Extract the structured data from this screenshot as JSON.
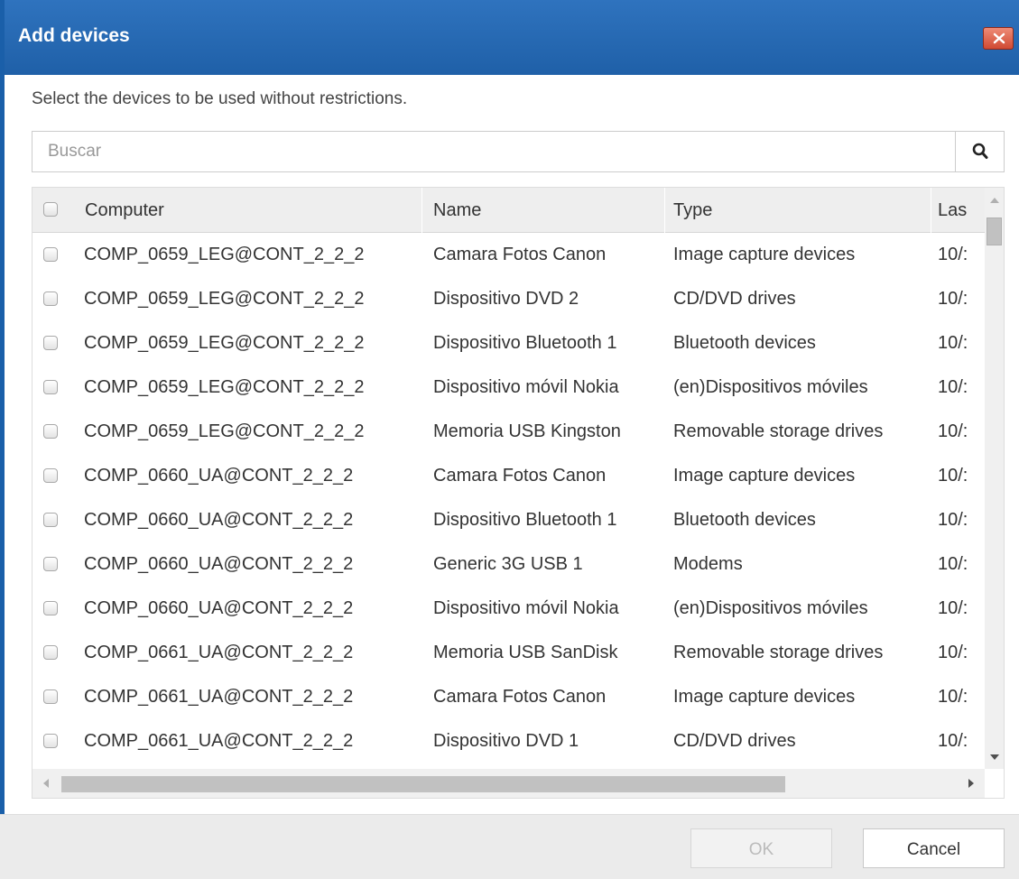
{
  "dialog": {
    "title": "Add devices",
    "description": "Select the devices to be used without restrictions."
  },
  "search": {
    "placeholder": "Buscar",
    "value": "",
    "icon": "search-icon"
  },
  "table": {
    "columns": [
      "Computer",
      "Name",
      "Type",
      "Las"
    ],
    "rows": [
      {
        "computer": "COMP_0659_LEG@CONT_2_2_2",
        "name": "Camara Fotos Canon",
        "type": "Image capture devices",
        "last": "10/:"
      },
      {
        "computer": "COMP_0659_LEG@CONT_2_2_2",
        "name": "Dispositivo DVD 2",
        "type": "CD/DVD drives",
        "last": "10/:"
      },
      {
        "computer": "COMP_0659_LEG@CONT_2_2_2",
        "name": "Dispositivo Bluetooth 1",
        "type": "Bluetooth devices",
        "last": "10/:"
      },
      {
        "computer": "COMP_0659_LEG@CONT_2_2_2",
        "name": "Dispositivo móvil Nokia",
        "type": "(en)Dispositivos móviles",
        "last": "10/:"
      },
      {
        "computer": "COMP_0659_LEG@CONT_2_2_2",
        "name": "Memoria USB Kingston",
        "type": "Removable storage drives",
        "last": "10/:"
      },
      {
        "computer": "COMP_0660_UA@CONT_2_2_2",
        "name": "Camara Fotos Canon",
        "type": "Image capture devices",
        "last": "10/:"
      },
      {
        "computer": "COMP_0660_UA@CONT_2_2_2",
        "name": "Dispositivo Bluetooth 1",
        "type": "Bluetooth devices",
        "last": "10/:"
      },
      {
        "computer": "COMP_0660_UA@CONT_2_2_2",
        "name": "Generic 3G USB 1",
        "type": "Modems",
        "last": "10/:"
      },
      {
        "computer": "COMP_0660_UA@CONT_2_2_2",
        "name": "Dispositivo móvil Nokia",
        "type": "(en)Dispositivos móviles",
        "last": "10/:"
      },
      {
        "computer": "COMP_0661_UA@CONT_2_2_2",
        "name": "Memoria USB SanDisk",
        "type": "Removable storage drives",
        "last": "10/:"
      },
      {
        "computer": "COMP_0661_UA@CONT_2_2_2",
        "name": "Camara Fotos Canon",
        "type": "Image capture devices",
        "last": "10/:"
      },
      {
        "computer": "COMP_0661_UA@CONT_2_2_2",
        "name": "Dispositivo DVD 1",
        "type": "CD/DVD drives",
        "last": "10/:"
      }
    ]
  },
  "buttons": {
    "ok": "OK",
    "ok_enabled": false,
    "cancel": "Cancel"
  },
  "colors": {
    "titlebar": "#1f60a8",
    "close_button": "#d04a33",
    "header_bg": "#eeeeee",
    "footer_bg": "#ebebeb"
  }
}
